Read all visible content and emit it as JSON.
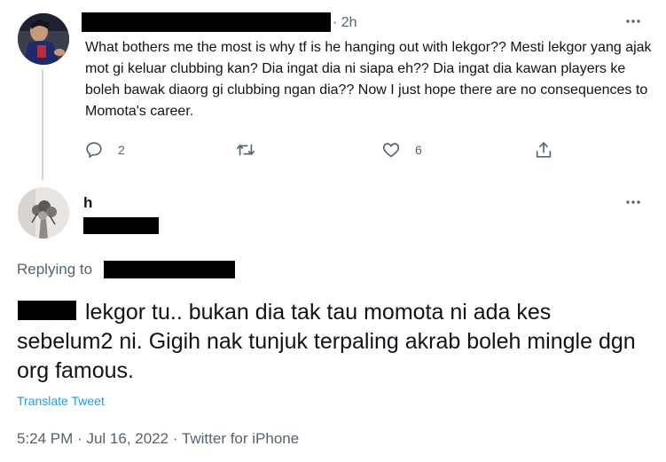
{
  "parent_tweet": {
    "time": "· 2h",
    "more_icon": "more-horizontal-icon",
    "text": "What bothers me the most is why tf is he hanging out with lekgor?? Mesti lekgor yang ajak mot gi keluar clubbing kan? Dia ingat dia ni siapa eh?? Dia ingat dia kawan players ke boleh bawak diaorg gi clubbing ngan dia?? Now I just hope there are no consequences to Momota's career.",
    "actions": {
      "reply_count": "2",
      "retweet_count": "",
      "like_count": "6"
    }
  },
  "reply_tweet": {
    "name": "h",
    "more_icon": "more-horizontal-icon",
    "replying_to_label": "Replying to",
    "text": "lekgor tu.. bukan dia tak tau momota ni ada kes sebelum2 ni. Gigih nak tunjuk terpaling akrab boleh mingle dgn org famous.",
    "translate_label": "Translate Tweet",
    "time": "5:24 PM",
    "date": "Jul 16, 2022",
    "source": "Twitter for iPhone",
    "separator": "·"
  },
  "colors": {
    "text": "#0f1419",
    "secondary": "#536471",
    "link": "#1d9bf0",
    "thread_line": "#cfd9de"
  }
}
